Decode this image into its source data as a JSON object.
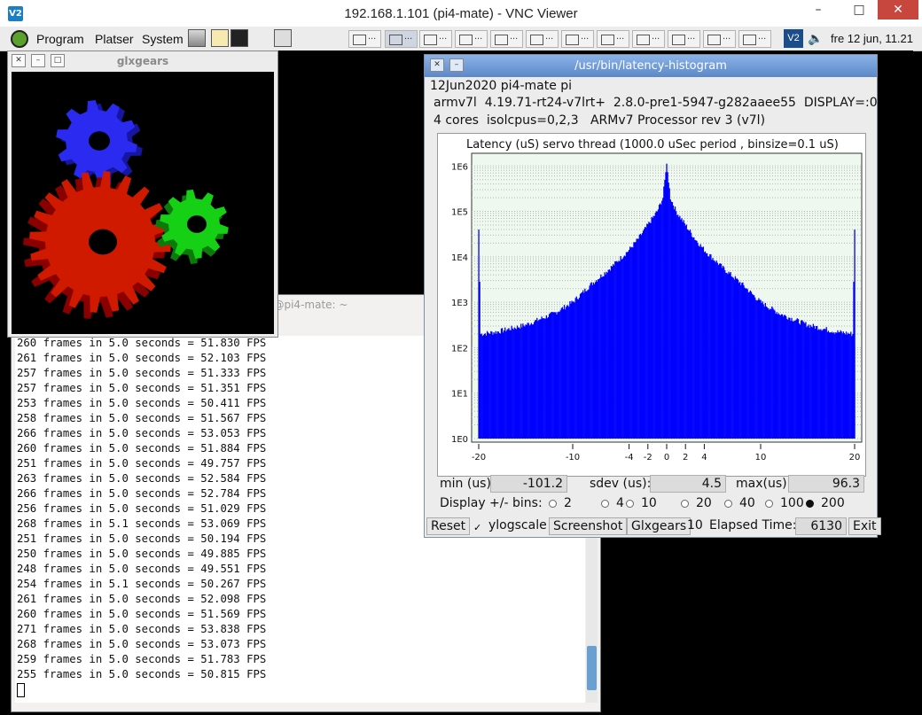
{
  "vnc": {
    "title": "192.168.1.101 (pi4-mate) - VNC Viewer",
    "logo": "V2",
    "minimize": "–",
    "maximize": "□",
    "close": "✕"
  },
  "panel": {
    "menus": [
      "Program",
      "Platser",
      "System"
    ],
    "task_label": "...",
    "tray_vnc": "V2",
    "volume_icon": "🔈",
    "clock": "fre 12 jun, 11.21"
  },
  "terminal": {
    "title": "pi@pi4-mate: ~",
    "lines": [
      "260 frames in 5.0 seconds = 51.830 FPS",
      "261 frames in 5.0 seconds = 52.103 FPS",
      "257 frames in 5.0 seconds = 51.333 FPS",
      "257 frames in 5.0 seconds = 51.351 FPS",
      "253 frames in 5.0 seconds = 50.411 FPS",
      "258 frames in 5.0 seconds = 51.567 FPS",
      "266 frames in 5.0 seconds = 53.053 FPS",
      "260 frames in 5.0 seconds = 51.884 FPS",
      "251 frames in 5.0 seconds = 49.757 FPS",
      "263 frames in 5.0 seconds = 52.584 FPS",
      "266 frames in 5.0 seconds = 52.784 FPS",
      "256 frames in 5.0 seconds = 51.029 FPS",
      "268 frames in 5.1 seconds = 53.069 FPS",
      "251 frames in 5.0 seconds = 50.194 FPS",
      "250 frames in 5.0 seconds = 49.885 FPS",
      "248 frames in 5.0 seconds = 49.551 FPS",
      "254 frames in 5.1 seconds = 50.267 FPS",
      "261 frames in 5.0 seconds = 52.098 FPS",
      "260 frames in 5.0 seconds = 51.569 FPS",
      "271 frames in 5.0 seconds = 53.838 FPS",
      "268 frames in 5.0 seconds = 53.073 FPS",
      "259 frames in 5.0 seconds = 51.783 FPS",
      "255 frames in 5.0 seconds = 50.815 FPS"
    ]
  },
  "glxgears": {
    "title": "glxgears",
    "close": "✕",
    "minimize": "–",
    "maximize": "□"
  },
  "latency": {
    "title": "/usr/bin/latency-histogram",
    "close": "✕",
    "minimize": "–",
    "info1": "12Jun2020 pi4-mate pi",
    "info2": "armv7l  4.19.71-rt24-v7lrt+  2.8.0-pre1-5947-g282aaee55  DISPLAY=:0",
    "info3": "4 cores  isolcpus=0,2,3   ARMv7 Processor rev 3 (v7l)",
    "min_label": "min (us)",
    "min_value": "-101.2",
    "sdev_label": "sdev (us):",
    "sdev_value": "4.5",
    "max_label": "max(us)",
    "max_value": "96.3",
    "bins_label": "Display +/- bins:",
    "bins_options": [
      "2",
      "4",
      "10",
      "20",
      "40",
      "100",
      "200"
    ],
    "bins_selected": "200",
    "reset_label": "Reset",
    "ylog_check": "✓",
    "ylog_label": "ylogscale",
    "screenshot_label": "Screenshot",
    "glxgears_label": "Glxgears",
    "glxgears_count": "10",
    "elapsed_label": "Elapsed Time:",
    "elapsed_value": "6130",
    "exit_label": "Exit"
  },
  "chart_data": {
    "type": "bar",
    "title": "Latency (uS) servo thread (1000.0 uSec period , binsize=0.1 uS)",
    "x_ticks": [
      -20,
      -10,
      -4,
      -2,
      0,
      2,
      4,
      10,
      20
    ],
    "y_ticks": [
      "1E0",
      "1E1",
      "1E2",
      "1E3",
      "1E4",
      "1E5",
      "1E6"
    ],
    "xlim": [
      -20,
      20
    ],
    "ylog_range": [
      0,
      6.2
    ],
    "y_scale": "log",
    "bar_color": "#0000ff",
    "background": "#eef8ee",
    "profile_x": [
      -20,
      -19.8,
      -18,
      -15,
      -12,
      -10,
      -8,
      -6,
      -4,
      -3,
      -2,
      -1,
      -0.4,
      0,
      0.4,
      1,
      2,
      3,
      4,
      6,
      8,
      10,
      12,
      15,
      18,
      19.8,
      20
    ],
    "profile_log": [
      4.6,
      2.3,
      2.35,
      2.5,
      2.75,
      3.0,
      3.4,
      3.75,
      4.15,
      4.4,
      4.7,
      5.0,
      5.3,
      6.05,
      5.3,
      5.0,
      4.7,
      4.4,
      4.15,
      3.75,
      3.4,
      3.0,
      2.75,
      2.5,
      2.35,
      2.3,
      4.6
    ]
  }
}
